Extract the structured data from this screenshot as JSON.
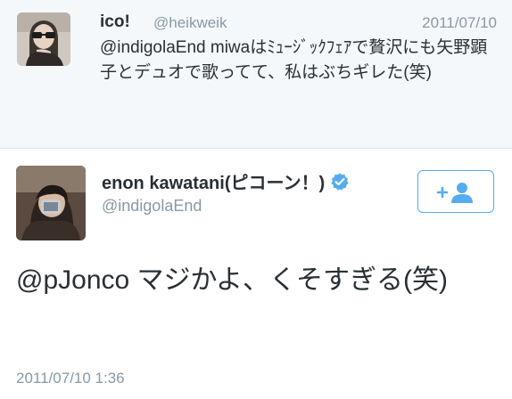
{
  "reply": {
    "name": "ico!",
    "handle": "@heikweik",
    "date": "2011/07/10",
    "text": "@indigolaEnd miwaはﾐｭｰｼﾞｯｸﾌｪｱで贅沢にも矢野顕子とデュオで歌ってて、私はぶちギレた(笑)",
    "avatar_icon": "user-avatar-icon"
  },
  "tweet": {
    "name": "enon kawatani(ピコーン！)",
    "handle": "@indigolaEnd",
    "verified_icon": "verified-badge-icon",
    "follow_icon": "follow-user-icon",
    "text": "@pJonco マジかよ、くそすぎる(笑)",
    "timestamp": "2011/07/10 1:36",
    "avatar_icon": "user-avatar-icon"
  },
  "colors": {
    "accent": "#55acee",
    "muted": "#8899a6",
    "text": "#292f33",
    "reply_background": "#f5f8fa"
  }
}
